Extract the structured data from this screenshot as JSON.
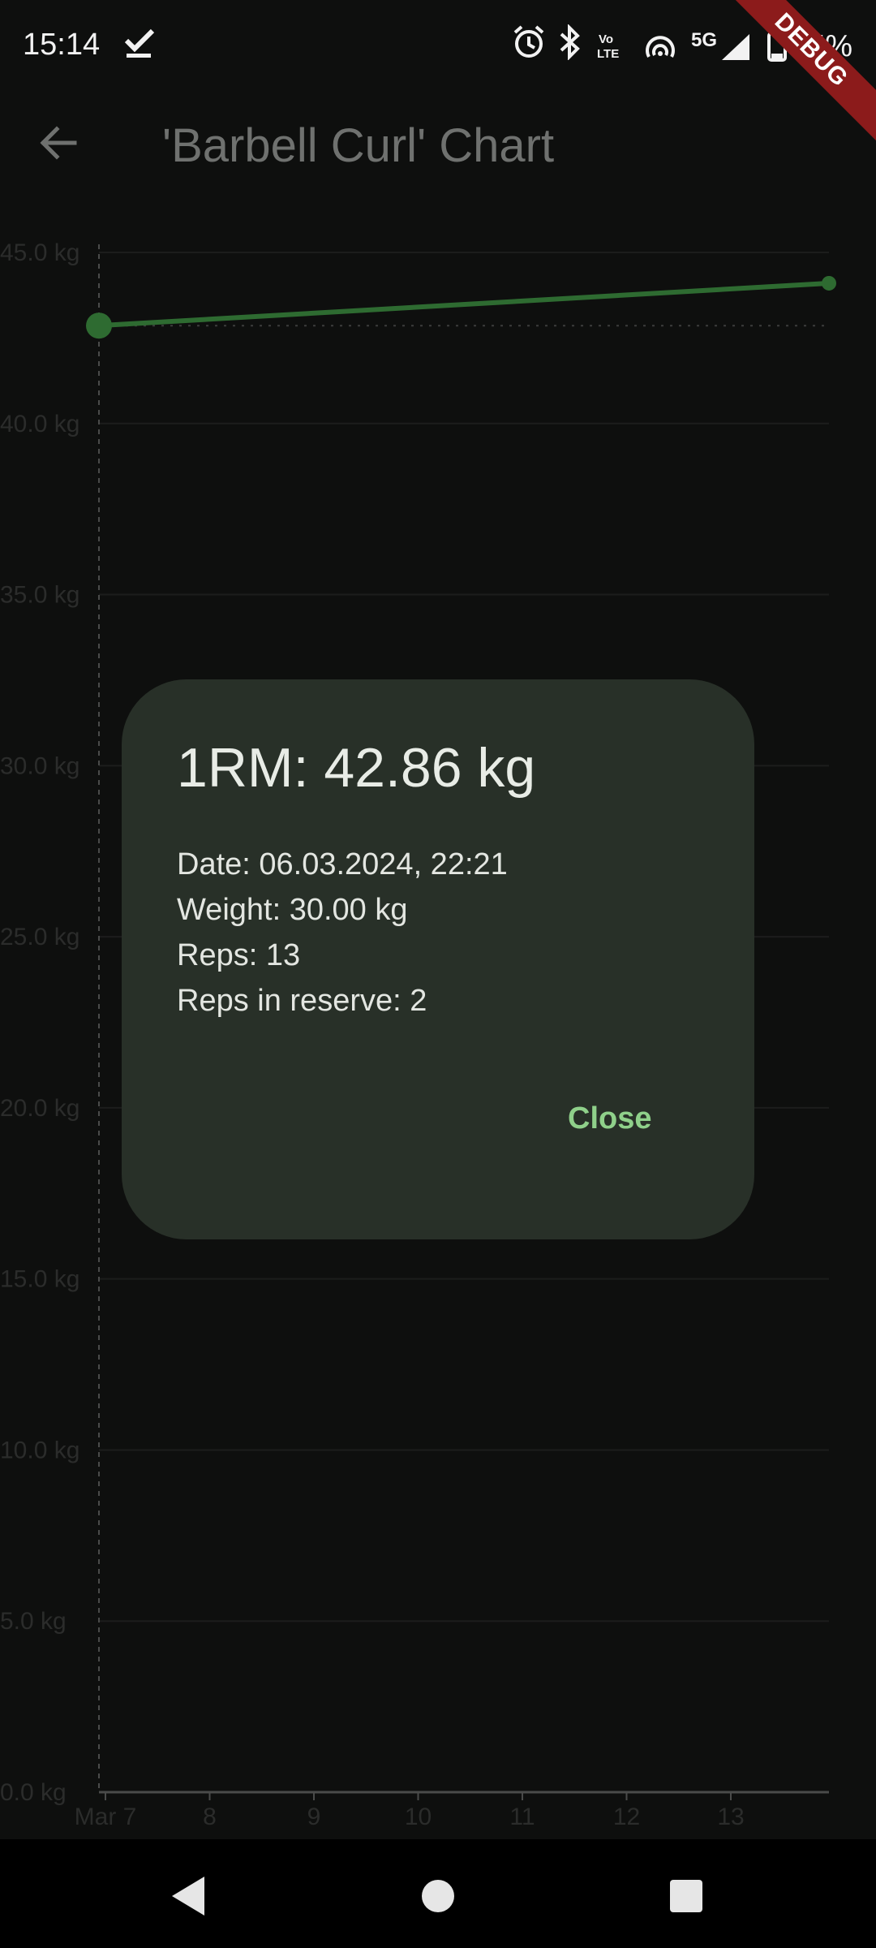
{
  "status_bar": {
    "time": "15:14",
    "network": "5G",
    "battery_text": "15%",
    "icons": [
      "checkmark-icon",
      "alarm-icon",
      "bluetooth-icon",
      "volte-icon",
      "hotspot-icon",
      "signal-icon",
      "battery-icon"
    ]
  },
  "debug_ribbon": "DEBUG",
  "app_bar": {
    "title": "'Barbell Curl' Chart",
    "back_icon": "arrow-back-icon"
  },
  "chart_data": {
    "type": "line",
    "title": "",
    "xlabel": "",
    "ylabel": "",
    "x_ticks": [
      "Mar 7",
      "8",
      "9",
      "10",
      "11",
      "12",
      "13"
    ],
    "y_ticks": [
      "0.0 kg",
      "5.0 kg",
      "10.0 kg",
      "15.0 kg",
      "20.0 kg",
      "25.0 kg",
      "30.0 kg",
      "35.0 kg",
      "40.0 kg",
      "45.0 kg"
    ],
    "ylim": [
      0,
      45
    ],
    "grid": true,
    "series": [
      {
        "points": [
          {
            "x": "2024-03-06",
            "y": 42.86
          },
          {
            "x": "2024-03-14",
            "y": 44.1
          }
        ]
      }
    ],
    "selected_point": {
      "x": "2024-03-06",
      "y": 42.86
    }
  },
  "dialog": {
    "title": "1RM: 42.86 kg",
    "date": "Date: 06.03.2024, 22:21",
    "weight": "Weight: 30.00 kg",
    "reps": "Reps: 13",
    "rir": "Reps in reserve: 2",
    "close_label": "Close"
  },
  "colors": {
    "background": "#0e0f0e",
    "line": "#2e6b31",
    "dialog": "#283028",
    "accent": "#8fd08a",
    "debug": "#8c1b1b"
  },
  "nav_bar": {
    "icons": [
      "back-triangle-icon",
      "home-circle-icon",
      "recents-square-icon"
    ]
  }
}
